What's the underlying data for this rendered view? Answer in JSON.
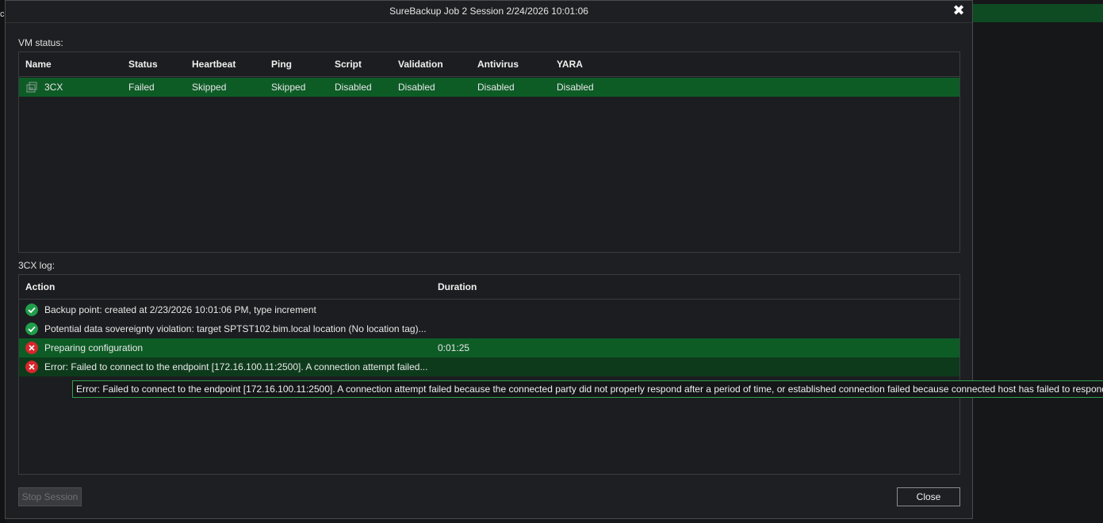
{
  "window": {
    "title": "SureBackup Job 2 Session 2/24/2026 10:01:06",
    "close_glyph": "✖"
  },
  "background": {
    "left_fragment": "c"
  },
  "vm_status": {
    "label": "VM status:",
    "columns": [
      "Name",
      "Status",
      "Heartbeat",
      "Ping",
      "Script",
      "Validation",
      "Antivirus",
      "YARA"
    ],
    "rows": [
      {
        "name": "3CX",
        "status": "Failed",
        "heartbeat": "Skipped",
        "ping": "Skipped",
        "script": "Disabled",
        "validation": "Disabled",
        "antivirus": "Disabled",
        "yara": "Disabled",
        "icon": "vm-icon"
      }
    ]
  },
  "log": {
    "label": "3CX log:",
    "columns": [
      "Action",
      "Duration"
    ],
    "rows": [
      {
        "icon": "success-icon",
        "action": "Backup point: created at 2/23/2026 10:01:06 PM, type increment",
        "duration": ""
      },
      {
        "icon": "success-icon",
        "action": "Potential data sovereignty violation: target SPTST102.bim.local location (No location tag)...",
        "duration": ""
      },
      {
        "icon": "error-icon",
        "action": "Preparing configuration",
        "duration": "0:01:25"
      },
      {
        "icon": "error-icon",
        "action": "Error: Failed to connect to the endpoint [172.16.100.11:2500]. A connection attempt failed...",
        "duration": ""
      }
    ]
  },
  "tooltip": {
    "text": "Error: Failed to connect to the endpoint [172.16.100.11:2500]. A connection attempt failed because the connected party did not properly respond after a period of time, or established connection failed because connected host has failed to respond"
  },
  "buttons": {
    "stop_session": "Stop Session",
    "close": "Close"
  },
  "colors": {
    "selected_row": "#0d5c26",
    "hover_row": "#0e3a1c",
    "success": "#1f9d4b",
    "error": "#d6262c",
    "tooltip_border": "#2fa24f"
  }
}
